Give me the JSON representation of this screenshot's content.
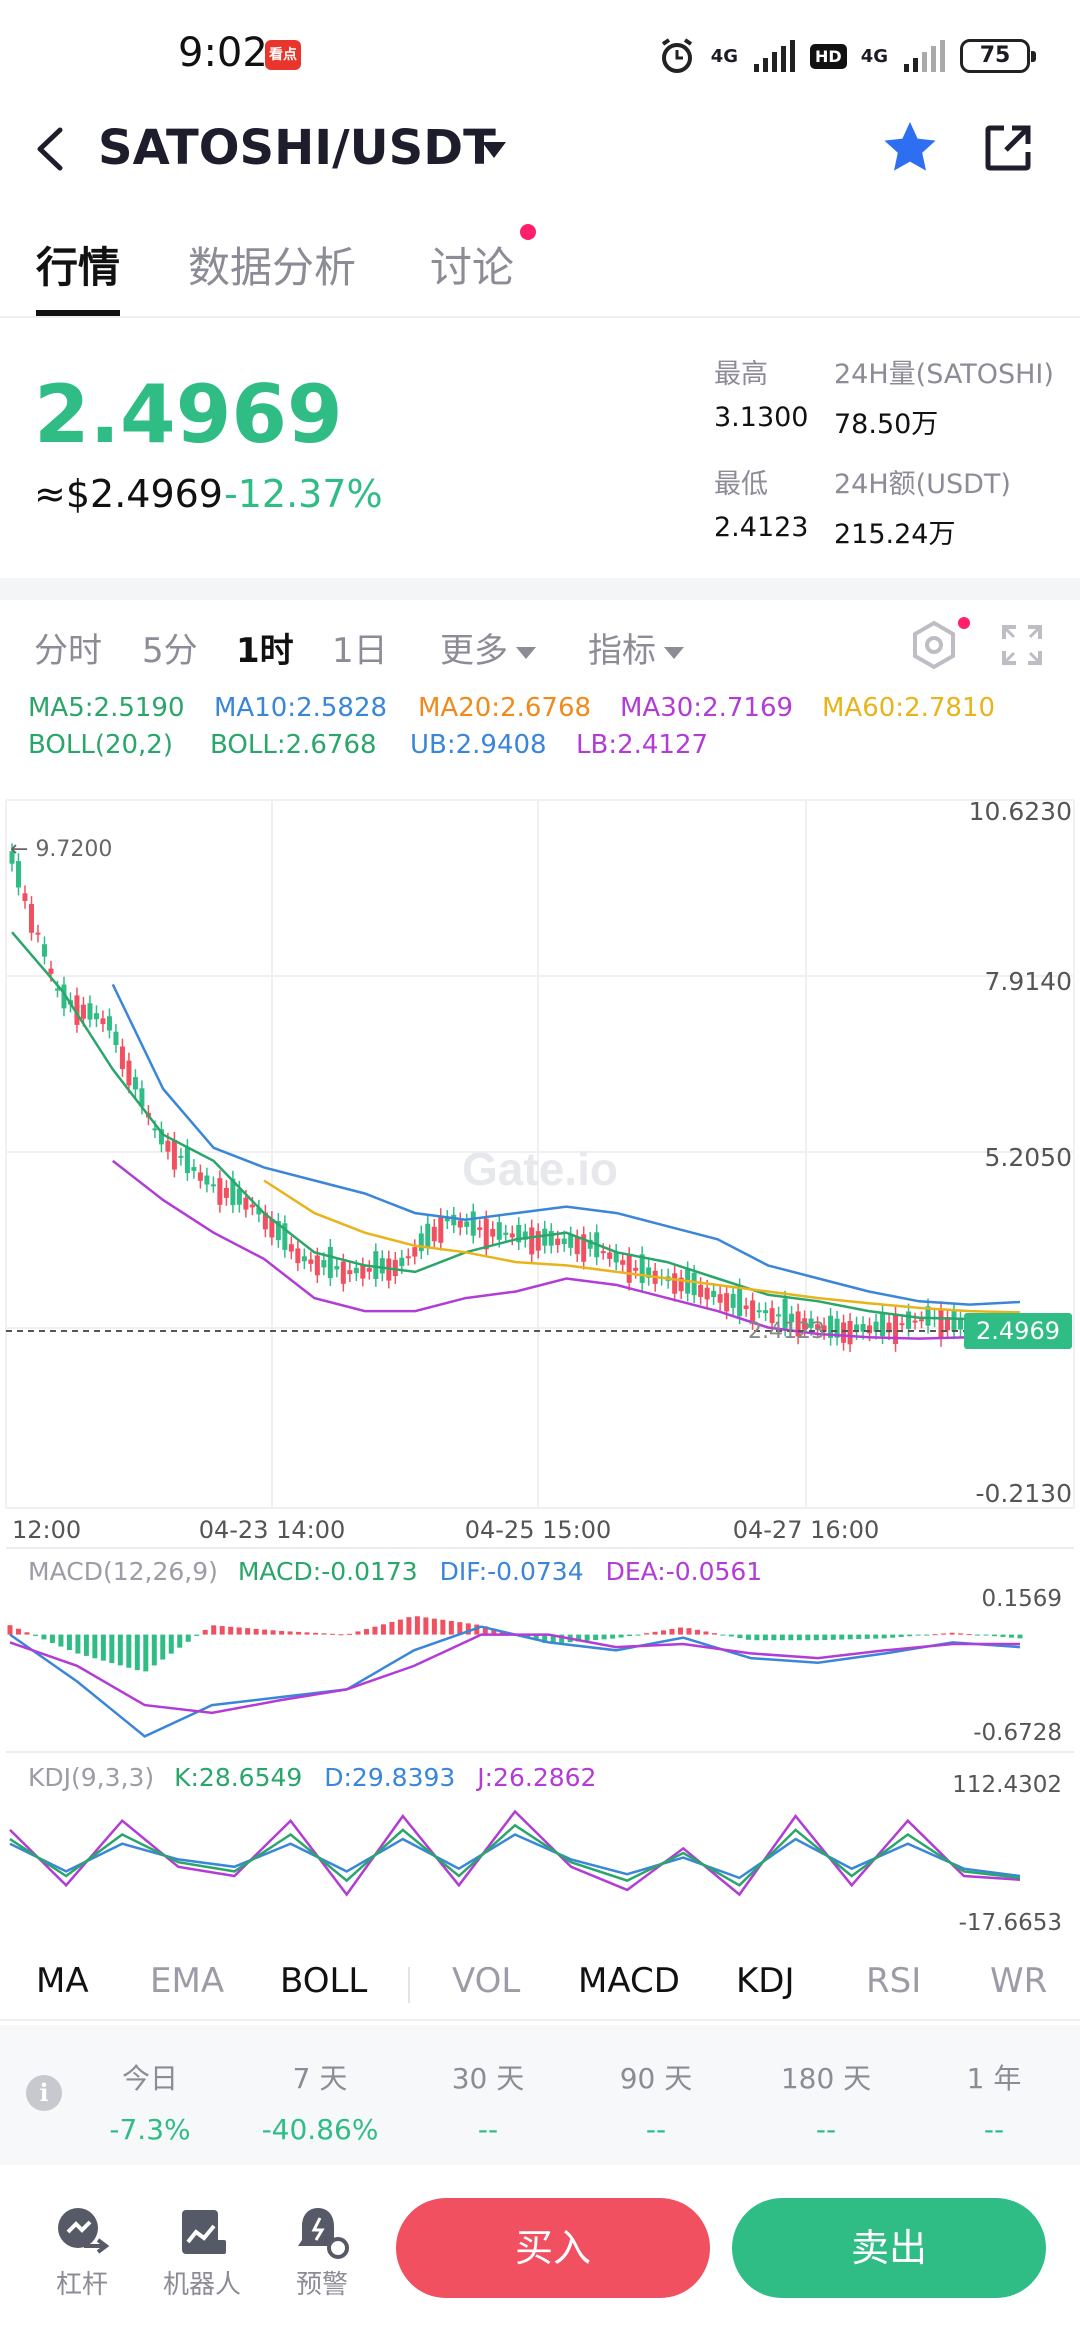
{
  "status": {
    "time": "9:02",
    "app_badge": "看点",
    "network1": "4G",
    "hd": "HD",
    "network2": "4G",
    "battery": "75"
  },
  "header": {
    "pair": "SATOSHI/USDT"
  },
  "tabs": [
    {
      "label": "行情",
      "active": true
    },
    {
      "label": "数据分析",
      "active": false
    },
    {
      "label": "讨论",
      "active": false
    }
  ],
  "ticker": {
    "last_price": "2.4969",
    "usd_price": "≈$2.4969",
    "change": "-12.37%",
    "high_label": "最高",
    "high": "3.1300",
    "low_label": "最低",
    "low": "2.4123",
    "vol_label": "24H量(SATOSHI)",
    "vol": "78.50万",
    "amt_label": "24H额(USDT)",
    "amt": "215.24万"
  },
  "intervals": [
    {
      "label": "分时",
      "active": false
    },
    {
      "label": "5分",
      "active": false
    },
    {
      "label": "1时",
      "active": true
    },
    {
      "label": "1日",
      "active": false
    }
  ],
  "more_label": "更多",
  "indicator_label": "指标",
  "ma_line": [
    {
      "text": "MA5:2.5190",
      "color": "#2aa66a"
    },
    {
      "text": "MA10:2.5828",
      "color": "#3a86d8"
    },
    {
      "text": "MA20:2.6768",
      "color": "#f08a1c"
    },
    {
      "text": "MA30:2.7169",
      "color": "#b23cd6"
    },
    {
      "text": "MA60:2.7810",
      "color": "#e9b31a"
    }
  ],
  "boll_line": [
    {
      "text": "BOLL(20,2)",
      "color": "#2aa66a"
    },
    {
      "text": "BOLL:2.6768",
      "color": "#2aa66a"
    },
    {
      "text": "UB:2.9408",
      "color": "#3a86d8"
    },
    {
      "text": "LB:2.4127",
      "color": "#b23cd6"
    }
  ],
  "chart_data": {
    "type": "line",
    "y_ticks": [
      "10.6230",
      "7.9140",
      "5.2050",
      "-0.2130"
    ],
    "ylim": [
      -0.213,
      10.623
    ],
    "x_ticks": [
      "12:00",
      "04-23 14:00",
      "04-25 15:00",
      "04-27 16:00"
    ],
    "max_marker": "9.7200",
    "min_marker": "2.4123",
    "current_price": "2.4969",
    "watermark": "Gate.io",
    "series": [
      {
        "name": "BOLL",
        "color": "#2aa66a",
        "values": [
          8.6,
          7.7,
          6.5,
          5.5,
          5.1,
          4.3,
          3.7,
          3.5,
          3.4,
          3.7,
          3.9,
          4.0,
          3.7,
          3.55,
          3.3,
          3.05,
          2.95,
          2.8,
          2.7,
          2.68,
          2.7
        ]
      },
      {
        "name": "UB",
        "color": "#3a86d8",
        "values": [
          null,
          null,
          7.8,
          6.2,
          5.3,
          5.0,
          4.8,
          4.6,
          4.3,
          4.2,
          4.3,
          4.4,
          4.3,
          4.1,
          3.9,
          3.5,
          3.3,
          3.1,
          2.95,
          2.9,
          2.94
        ]
      },
      {
        "name": "LB",
        "color": "#b23cd6",
        "values": [
          null,
          null,
          5.1,
          4.5,
          4.0,
          3.6,
          3.0,
          2.8,
          2.8,
          3.0,
          3.1,
          3.3,
          3.2,
          3.0,
          2.8,
          2.55,
          2.45,
          2.4,
          2.38,
          2.4,
          2.41
        ]
      },
      {
        "name": "MA60",
        "color": "#e9b31a",
        "values": [
          null,
          null,
          null,
          null,
          null,
          4.8,
          4.3,
          4.0,
          3.8,
          3.7,
          3.55,
          3.5,
          3.4,
          3.3,
          3.2,
          3.1,
          3.0,
          2.92,
          2.85,
          2.8,
          2.78
        ]
      },
      {
        "name": "Price",
        "color": "#2fbd85",
        "values": [
          9.72,
          7.6,
          7.2,
          5.5,
          4.8,
          4.4,
          3.6,
          3.4,
          3.5,
          4.2,
          4.0,
          3.9,
          3.8,
          3.4,
          3.2,
          2.9,
          2.7,
          2.5,
          2.55,
          2.7,
          2.4969
        ]
      }
    ]
  },
  "macd": {
    "header": "MACD(12,26,9)",
    "macd": "MACD:-0.0173",
    "dif": "DIF:-0.0734",
    "dea": "DEA:-0.0561",
    "top": "0.1569",
    "bottom": "-0.6728",
    "ylim": [
      -0.6728,
      0.1569
    ],
    "dif_values": [
      0.0,
      -0.3,
      -0.65,
      -0.45,
      -0.4,
      -0.35,
      -0.1,
      0.05,
      -0.05,
      -0.1,
      -0.02,
      -0.15,
      -0.18,
      -0.12,
      -0.05,
      -0.08
    ],
    "dea_values": [
      -0.05,
      -0.2,
      -0.45,
      -0.5,
      -0.42,
      -0.35,
      -0.2,
      0.0,
      0.0,
      -0.08,
      -0.06,
      -0.12,
      -0.15,
      -0.1,
      -0.06,
      -0.06
    ]
  },
  "kdj": {
    "header": "KDJ(9,3,3)",
    "k": "K:28.6549",
    "d": "D:29.8393",
    "j": "J:26.2862",
    "top": "112.4302",
    "bottom": "-17.6653",
    "ylim": [
      -17.6653,
      112.4302
    ],
    "j_values": [
      80,
      20,
      90,
      40,
      30,
      90,
      10,
      95,
      20,
      100,
      40,
      15,
      60,
      10,
      95,
      20,
      90,
      30,
      26
    ],
    "k_values": [
      70,
      30,
      75,
      45,
      35,
      75,
      25,
      80,
      30,
      85,
      45,
      25,
      55,
      20,
      80,
      30,
      75,
      35,
      28
    ],
    "d_values": [
      65,
      35,
      65,
      48,
      40,
      65,
      35,
      70,
      38,
      75,
      48,
      32,
      50,
      28,
      70,
      38,
      65,
      38,
      30
    ]
  },
  "indicator_tabs": [
    {
      "label": "MA",
      "on": true
    },
    {
      "label": "EMA",
      "on": false
    },
    {
      "label": "BOLL",
      "on": true
    },
    {
      "label": "VOL",
      "on": false
    },
    {
      "label": "MACD",
      "on": true
    },
    {
      "label": "KDJ",
      "on": true
    },
    {
      "label": "RSI",
      "on": false
    },
    {
      "label": "WR",
      "on": false
    }
  ],
  "performance": [
    {
      "label": "今日",
      "value": "-7.3%",
      "color": "#2fbd85"
    },
    {
      "label": "7 天",
      "value": "-40.86%",
      "color": "#2fbd85"
    },
    {
      "label": "30 天",
      "value": "--",
      "color": "#2fbd85"
    },
    {
      "label": "90 天",
      "value": "--",
      "color": "#2fbd85"
    },
    {
      "label": "180 天",
      "value": "--",
      "color": "#2fbd85"
    },
    {
      "label": "1 年",
      "value": "--",
      "color": "#2fbd85"
    }
  ],
  "bottom": {
    "leverage": "杠杆",
    "robot": "机器人",
    "alert": "预警",
    "buy": "买入",
    "sell": "卖出"
  },
  "colors": {
    "up": "#f0505f",
    "down": "#2fbd85",
    "accent": "#2e6ff2"
  }
}
